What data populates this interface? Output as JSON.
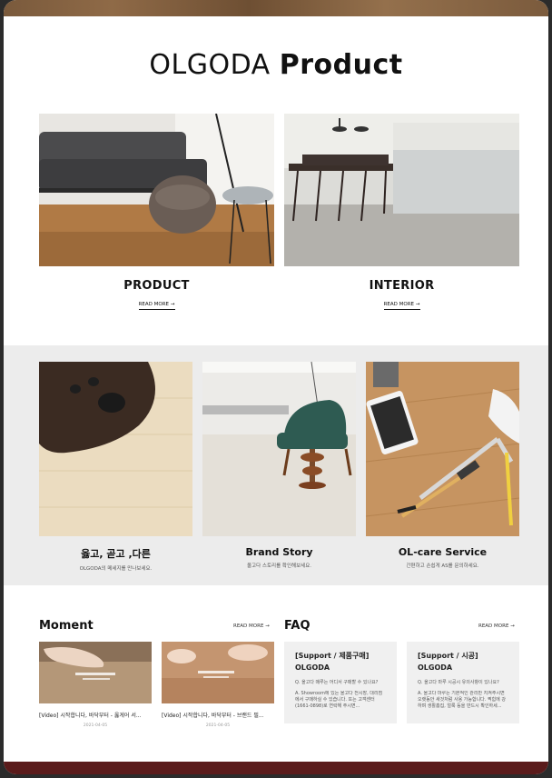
{
  "header": {
    "title_light": "OLGODA",
    "title_bold": "Product"
  },
  "top_cards": [
    {
      "label": "PRODUCT",
      "more": "READ MORE →"
    },
    {
      "label": "INTERIOR",
      "more": "READ MORE →"
    }
  ],
  "mid_cards": [
    {
      "label": "옳고, 곧고 ,다른",
      "sub": "OLGODA의 메세지를 만나보세요."
    },
    {
      "label": "Brand Story",
      "sub": "올고다 스토리를 확인해보세요."
    },
    {
      "label": "OL-care Service",
      "sub": "간편하고 손쉽게 AS를 문의하세요."
    }
  ],
  "moment": {
    "title": "Moment",
    "more": "READ MORE →",
    "items": [
      {
        "caption": "[Video] 시작합니다, 바닥부터 - 옳게어 서...",
        "date": "2021-04-05"
      },
      {
        "caption": "[Video] 시작합니다, 바닥부터 - 브랜드 필...",
        "date": "2021-04-05"
      }
    ]
  },
  "faq": {
    "title": "FAQ",
    "more": "READ MORE →",
    "items": [
      {
        "category": "[Support / 제품구매]",
        "brand": "OLGODA",
        "q": "Q. 올고다 매루는 어디서 구매할 수 있나요?",
        "a": "A. Showroom에 있는 올고다 전시장, 대리점에서 구매하실 수 있습니다. 또는 고객센터(1661-0898)로 연락해 주시면..."
      },
      {
        "category": "[Support / 시공]",
        "brand": "OLGODA",
        "q": "Q. 올고다 마루 시공시 유의사항이 있나요?",
        "a": "A. 올고다 마루는 기본적인 관리만 지켜주시면 오랫동안 새것처럼 사용 가능합니다. 찍힘에 강하며 생활흠집, 얼룩 등을 반드시 확인하세..."
      }
    ]
  },
  "colors": {
    "band_gray": "#ececec",
    "faq_bg": "#f0f0f0",
    "bottom_bar": "#5a1b1b"
  }
}
